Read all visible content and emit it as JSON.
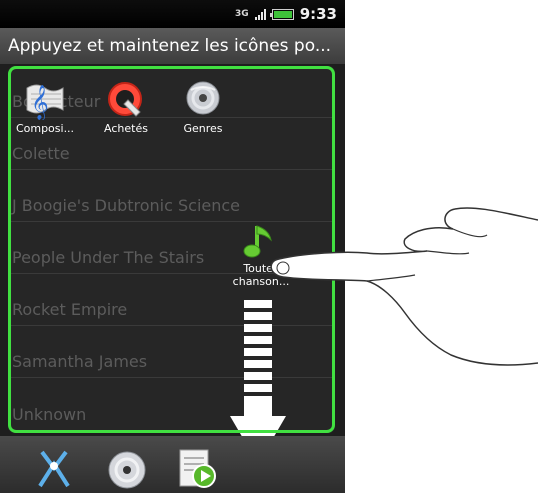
{
  "status_bar": {
    "network": "3G",
    "time": "9:33",
    "battery_color": "#3ec23a"
  },
  "title": "Appuyez et maintenez les icônes po...",
  "list_items": [
    "Bob Acteur",
    "Colette",
    "J Boogie's Dubtronic Science",
    "People Under The Stairs",
    "Rocket Empire",
    "Samantha James",
    "Unknown"
  ],
  "drop_zone_icons": [
    {
      "label": "Composi...",
      "icon": "composer-icon"
    },
    {
      "label": "Achetés",
      "icon": "purchased-icon"
    },
    {
      "label": "Genres",
      "icon": "genres-icon"
    }
  ],
  "dragged_item": {
    "label_line1": "Toutes",
    "label_line2": "chanson...",
    "icon": "music-note-icon"
  },
  "tab_bar": [
    {
      "icon": "artists-icon"
    },
    {
      "icon": "albums-icon"
    },
    {
      "icon": "playlists-icon"
    }
  ],
  "accent_color": "#41e041"
}
